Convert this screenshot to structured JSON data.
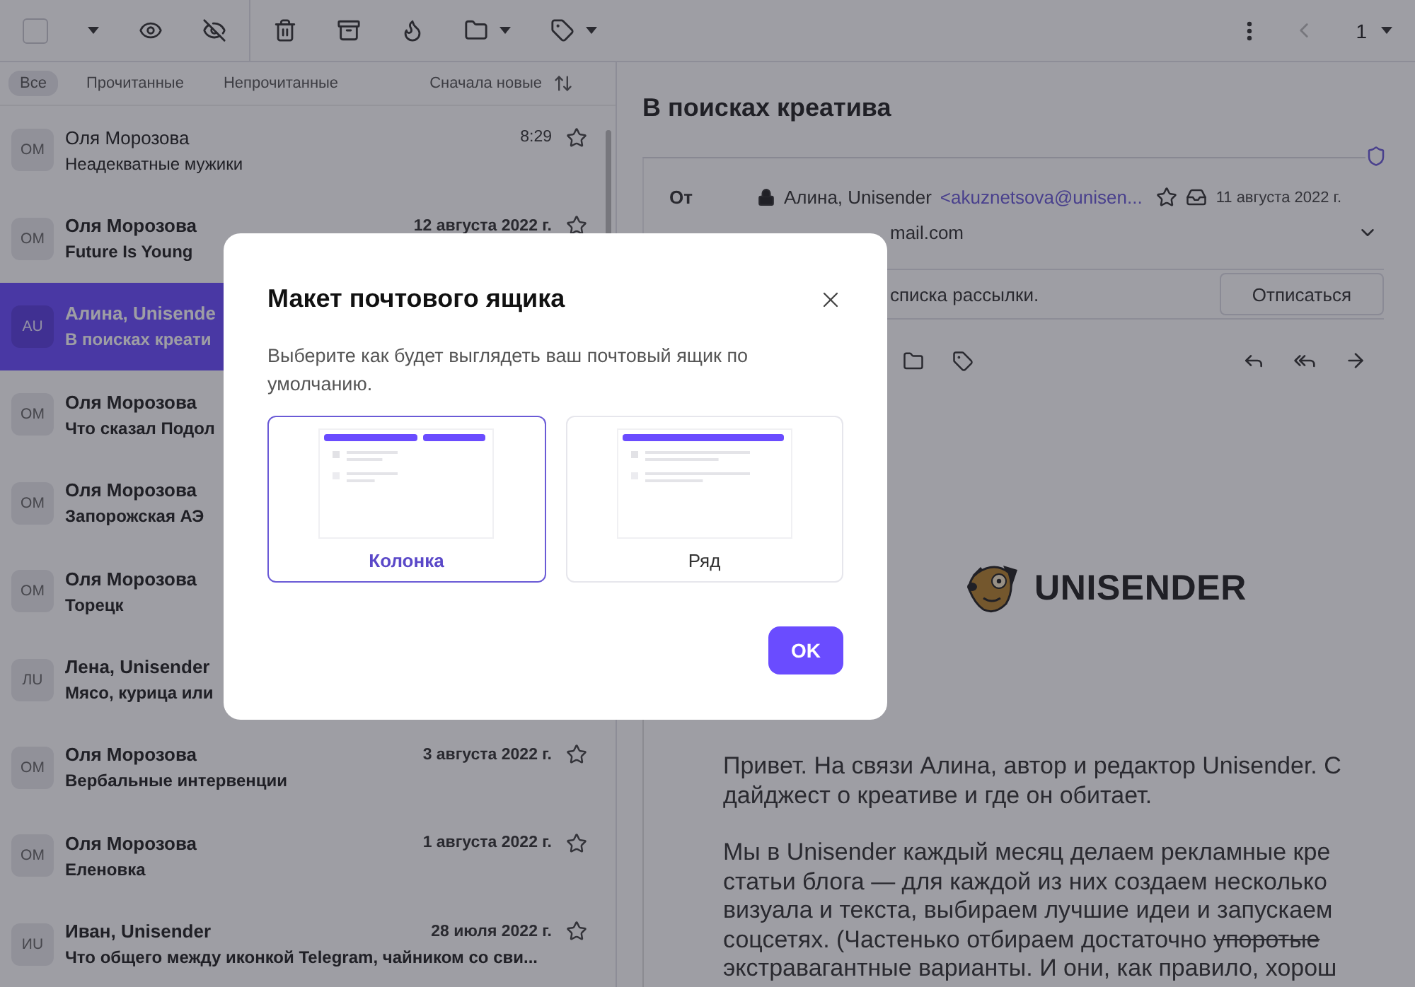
{
  "toolbar": {
    "select_all": {
      "checked": false
    }
  },
  "pager": {
    "page": "1"
  },
  "filters": [
    {
      "label": "Все",
      "selected": true
    },
    {
      "label": "Прочитанные",
      "selected": false
    },
    {
      "label": "Непрочитанные",
      "selected": false
    }
  ],
  "sort": {
    "label": "Сначала новые"
  },
  "messages": [
    {
      "initials": "ОМ",
      "sender": "Оля Морозова",
      "subject": "Неадекватные мужики",
      "date": "8:29",
      "unread": false,
      "selected": false,
      "starred": false
    },
    {
      "initials": "ОМ",
      "sender": "Оля Морозова",
      "subject": "Future Is Young",
      "date": "12 августа 2022 г.",
      "unread": true,
      "selected": false,
      "starred": false
    },
    {
      "initials": "AU",
      "sender": "Алина, Unisende",
      "subject": "В поисках креати",
      "unread": true,
      "selected": true
    },
    {
      "initials": "ОМ",
      "sender": "Оля Морозова",
      "subject": "Что сказал Подол",
      "unread": true,
      "selected": false
    },
    {
      "initials": "ОМ",
      "sender": "Оля Морозова",
      "subject": "Запорожская АЭ",
      "unread": true,
      "selected": false
    },
    {
      "initials": "ОМ",
      "sender": "Оля Морозова",
      "subject": "Торецк",
      "unread": true,
      "selected": false
    },
    {
      "initials": "ЛU",
      "sender": "Лена, Unisender",
      "subject": "Мясо, курица или",
      "unread": true,
      "selected": false
    },
    {
      "initials": "ОМ",
      "sender": "Оля Морозова",
      "subject": "Вербальные интервенции",
      "date": "3 августа 2022 г.",
      "unread": true,
      "selected": false,
      "starred": false
    },
    {
      "initials": "ОМ",
      "sender": "Оля Морозова",
      "subject": "Еленовка",
      "date": "1 августа 2022 г.",
      "unread": true,
      "selected": false,
      "starred": false
    },
    {
      "initials": "ИU",
      "sender": "Иван, Unisender",
      "subject": "Что общего между иконкой Telegram, чайником со сви...",
      "date": "28 июля 2022 г.",
      "unread": true,
      "selected": false,
      "starred": false
    }
  ],
  "email": {
    "title": "В поисках креатива",
    "from_label": "От",
    "sender": "Алина, Unisender",
    "address": "<akuznetsova@unisen...",
    "starred": false,
    "date": "11 августа 2022 г.",
    "recipient": "mail.com",
    "unsubscribe_note": "списка рассылки.",
    "unsubscribe_button": "Отписаться",
    "logo_text": "UNISENDER",
    "paragraphs": [
      [
        [
          {
            "text": "Привет. На связи Алина, автор и редактор Unisender. С",
            "struck": false
          }
        ],
        [
          {
            "text": "дайджест о креативе и где он обитает.",
            "struck": false
          }
        ]
      ],
      [
        [
          {
            "text": "Мы в Unisender каждый месяц делаем рекламные кре",
            "struck": false
          }
        ],
        [
          {
            "text": "статьи блога — для каждой из них создаем несколько",
            "struck": false
          }
        ],
        [
          {
            "text": "визуала и текста, выбираем лучшие идеи и запускаем",
            "struck": false
          }
        ],
        [
          {
            "text": "соцсетях. (Частенько отбираем достаточно ",
            "struck": false
          },
          {
            "text": "упоротые",
            "struck": true
          }
        ],
        [
          {
            "text": "экстравагантные варианты. И они, как правило, хорош",
            "struck": false
          }
        ]
      ]
    ]
  },
  "dialog": {
    "title": "Макет почтового ящика",
    "description": "Выберите как будет выглядеть ваш почтовый ящик по умолчанию.",
    "options": [
      {
        "label": "Колонка",
        "kind": "column",
        "selected": true
      },
      {
        "label": "Ряд",
        "kind": "row",
        "selected": false
      }
    ],
    "ok_button": "OK"
  }
}
